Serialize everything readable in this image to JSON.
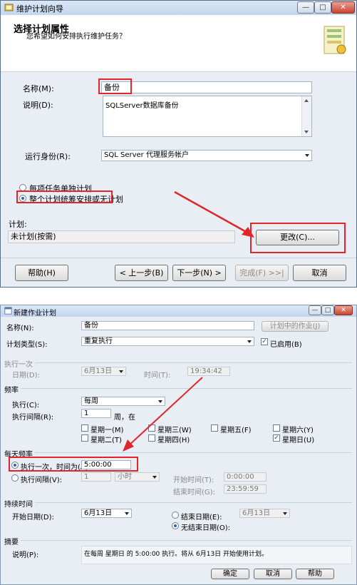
{
  "wizard": {
    "title": "维护计划向导",
    "controls": {
      "minimize": "—",
      "maximize": "□",
      "close": "✕"
    },
    "header_title": "选择计划属性",
    "header_subtitle": "您希望如何安排执行维护任务？",
    "name_label": "名称(M):",
    "name_value": "备份",
    "desc_label": "说明(D):",
    "desc_value": "SQLServer数据库备份",
    "runas_label": "运行身份(R):",
    "runas_value": "SQL Server 代理服务帐户",
    "radio_separate": "每项任务单独计划",
    "radio_single": "整个计划统筹安排或无计划",
    "schedule_label": "计划:",
    "schedule_value": "未计划(按需)",
    "change_button": "更改(C)...",
    "help_button": "帮助(H)",
    "prev_button": "< 上一步(B)",
    "next_button": "下一步(N) >",
    "finish_button": "完成(F) >>|",
    "cancel_button": "取消"
  },
  "job": {
    "title": "新建作业计划",
    "controls": {
      "minimize": "—",
      "maximize": "□",
      "close": "✕"
    },
    "name_label": "名称(N):",
    "name_value": "备份",
    "jobs_button": "计划中的作业(J)",
    "type_label": "计划类型(S):",
    "type_value": "重复执行",
    "enabled_label": "已启用(B)",
    "once_section": "执行一次",
    "date_label": "日期(D):",
    "date_value": "6月13日",
    "time_label": "时间(T):",
    "time_value": "19:34:42",
    "freq_section": "频率",
    "exec_label": "执行(C):",
    "exec_value": "每周",
    "interval_label": "执行间隔(R):",
    "interval_value": "1",
    "interval_unit": "周，在",
    "days": [
      {
        "label": "星期一(M)",
        "checked": false
      },
      {
        "label": "星期三(W)",
        "checked": false
      },
      {
        "label": "星期五(F)",
        "checked": false
      },
      {
        "label": "星期六(Y)",
        "checked": false
      },
      {
        "label": "星期二(T)",
        "checked": false
      },
      {
        "label": "星期四(H)",
        "checked": false
      },
      {
        "label": "星期日(U)",
        "checked": true
      }
    ],
    "daily_section": "每天频率",
    "once_at_label": "执行一次，时间为(A):",
    "once_at_value": "5:00:00",
    "every_label": "执行间隔(V):",
    "every_value": "1",
    "every_unit": "小时",
    "start_time_label": "开始时间(T):",
    "start_time_value": "0:00:00",
    "end_time_label": "结束时间(G):",
    "end_time_value": "23:59:59",
    "duration_section": "持续时间",
    "start_date_label": "开始日期(D):",
    "start_date_value": "6月13日",
    "end_date_label": "结束日期(E):",
    "end_date_value": "6月13日",
    "no_end_label": "无结束日期(O):",
    "summary_section": "摘要",
    "summary_label": "说明(P):",
    "summary_value": "在每周 星期日 的 5:00:00 执行。将从 6月13日 开始使用计划。",
    "ok_button": "确定",
    "cancel_button": "取消",
    "help_button": "帮助"
  },
  "colors": {
    "annotation_red": "#e0262a",
    "title_bar": "#c3d5ee"
  }
}
